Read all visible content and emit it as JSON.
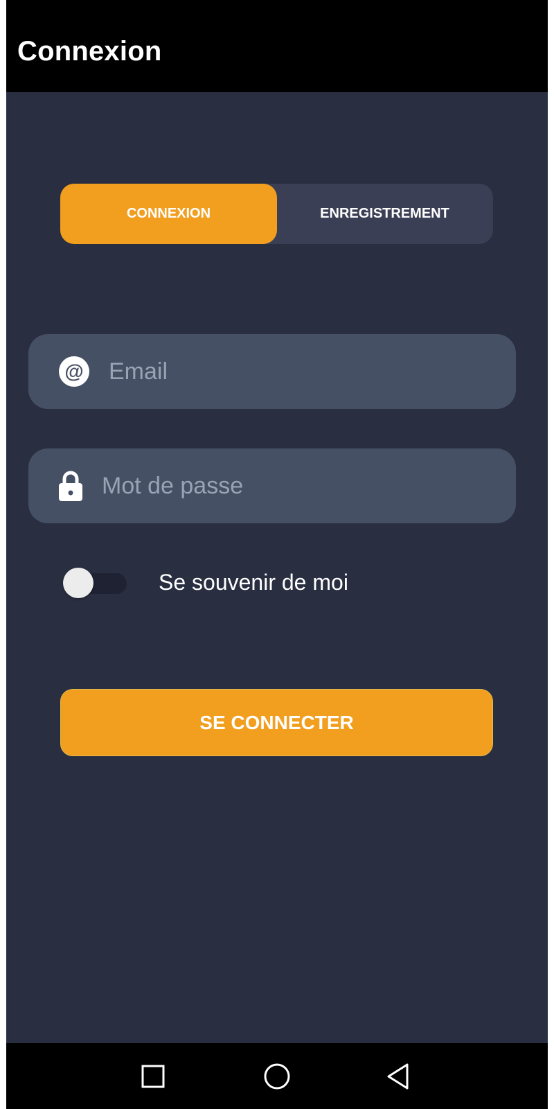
{
  "app_bar": {
    "title": "Connexion"
  },
  "tabs": [
    {
      "label": "CONNEXION",
      "active": true
    },
    {
      "label": "ENREGISTREMENT",
      "active": false
    }
  ],
  "form": {
    "email": {
      "value": "",
      "placeholder": "Email",
      "icon": "at-icon"
    },
    "password": {
      "value": "",
      "placeholder": "Mot de passe",
      "icon": "lock-icon"
    },
    "remember_me": {
      "label": "Se souvenir de moi",
      "checked": false
    },
    "submit_label": "SE CONNECTER"
  },
  "nav_bar": {
    "icons": [
      "recent-apps-icon",
      "home-icon",
      "back-icon"
    ]
  },
  "colors": {
    "background": "#292e41",
    "accent": "#f29e1e",
    "field": "#465065",
    "tab_inactive": "#3a3f55",
    "bars": "#000000"
  }
}
